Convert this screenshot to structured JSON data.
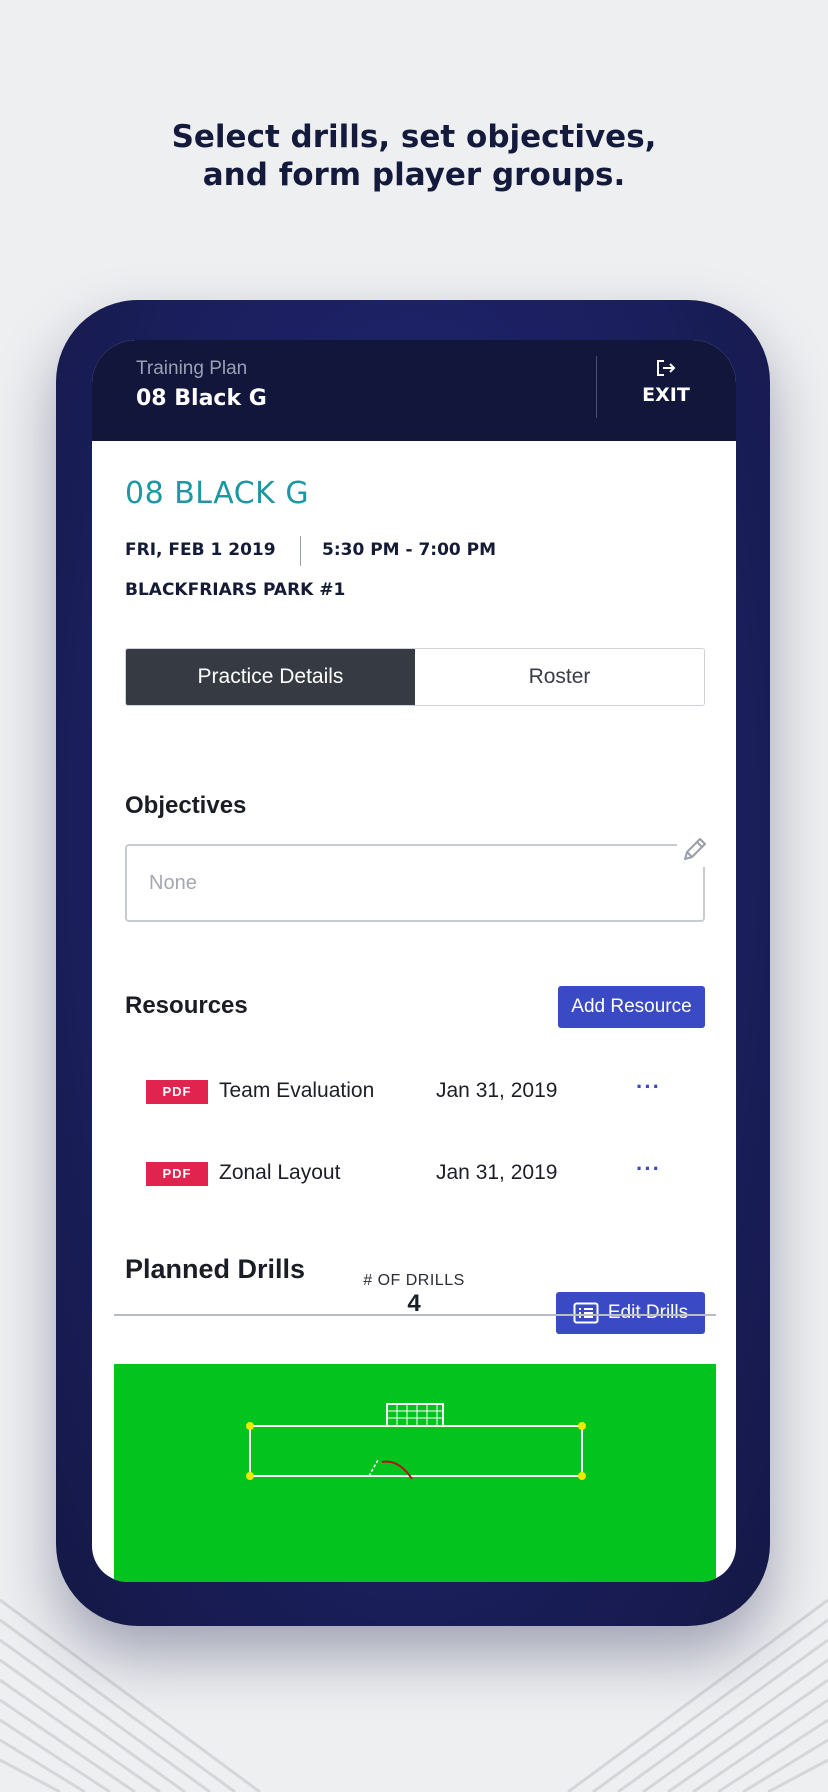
{
  "headline": {
    "line1": "Select drills, set objectives,",
    "line2": "and form player groups."
  },
  "topbar": {
    "label": "Training Plan",
    "title": "08 Black G",
    "exit_label": "EXIT"
  },
  "practice": {
    "team_name": "08 BLACK G",
    "date": "FRI, FEB 1 2019",
    "time": "5:30 PM - 7:00 PM",
    "location": "BLACKFRIARS PARK #1"
  },
  "tabs": [
    {
      "label": "Practice Details",
      "active": true
    },
    {
      "label": "Roster",
      "active": false
    }
  ],
  "objectives": {
    "heading": "Objectives",
    "placeholder": "None"
  },
  "resources": {
    "heading": "Resources",
    "add_button": "Add Resource",
    "items": [
      {
        "type": "PDF",
        "name": "Team Evaluation",
        "date": "Jan 31, 2019",
        "more": "···"
      },
      {
        "type": "PDF",
        "name": "Zonal Layout",
        "date": "Jan 31, 2019",
        "more": "···"
      }
    ]
  },
  "drills": {
    "heading": "Planned Drills",
    "edit_button": "Edit Drills",
    "count_label": "# OF DRILLS",
    "count": "4"
  },
  "colors": {
    "navy": "#11163a",
    "accent_teal": "#1e97a5",
    "button_blue": "#3a4ac4",
    "pdf_red": "#e0244d",
    "field_green": "#03c31f"
  }
}
